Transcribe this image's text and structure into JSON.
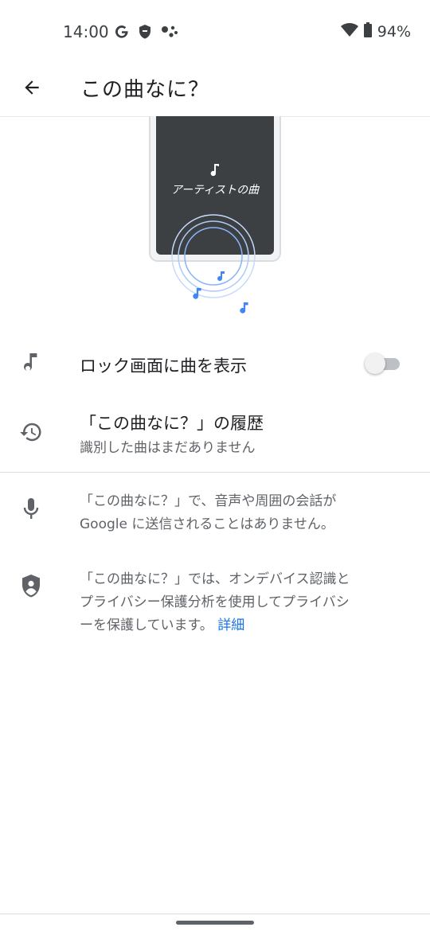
{
  "status_bar": {
    "time": "14:00",
    "battery": "94%",
    "icons_left": [
      "google-g-icon",
      "shield-icon",
      "assistant-icon"
    ],
    "icons_right": [
      "wifi-icon",
      "battery-icon"
    ]
  },
  "app_bar": {
    "back_icon": "arrow-back-icon",
    "title": "この曲なに？"
  },
  "illustration": {
    "now_playing": "アーティストの曲",
    "accent_color": "#4285f4"
  },
  "settings": {
    "lock_screen": {
      "icon": "music-note-icon",
      "label": "ロック画面に曲を表示",
      "enabled": false
    },
    "history": {
      "icon": "history-icon",
      "title": "「この曲なに？」の履歴",
      "subtitle": "識別した曲はまだありません"
    }
  },
  "info": {
    "mic": {
      "icon": "mic-icon",
      "line1": "「この曲なに？」で、音声や周囲の会話が",
      "line2": "Google に送信されることはありません。"
    },
    "privacy": {
      "icon": "privacy-shield-icon",
      "line1": "「この曲なに？」では、オンデバイス認識と",
      "line2": "プライバシー保護分析を使用してプライバシ",
      "line3": "ーを保護しています。",
      "link": "詳細"
    }
  }
}
